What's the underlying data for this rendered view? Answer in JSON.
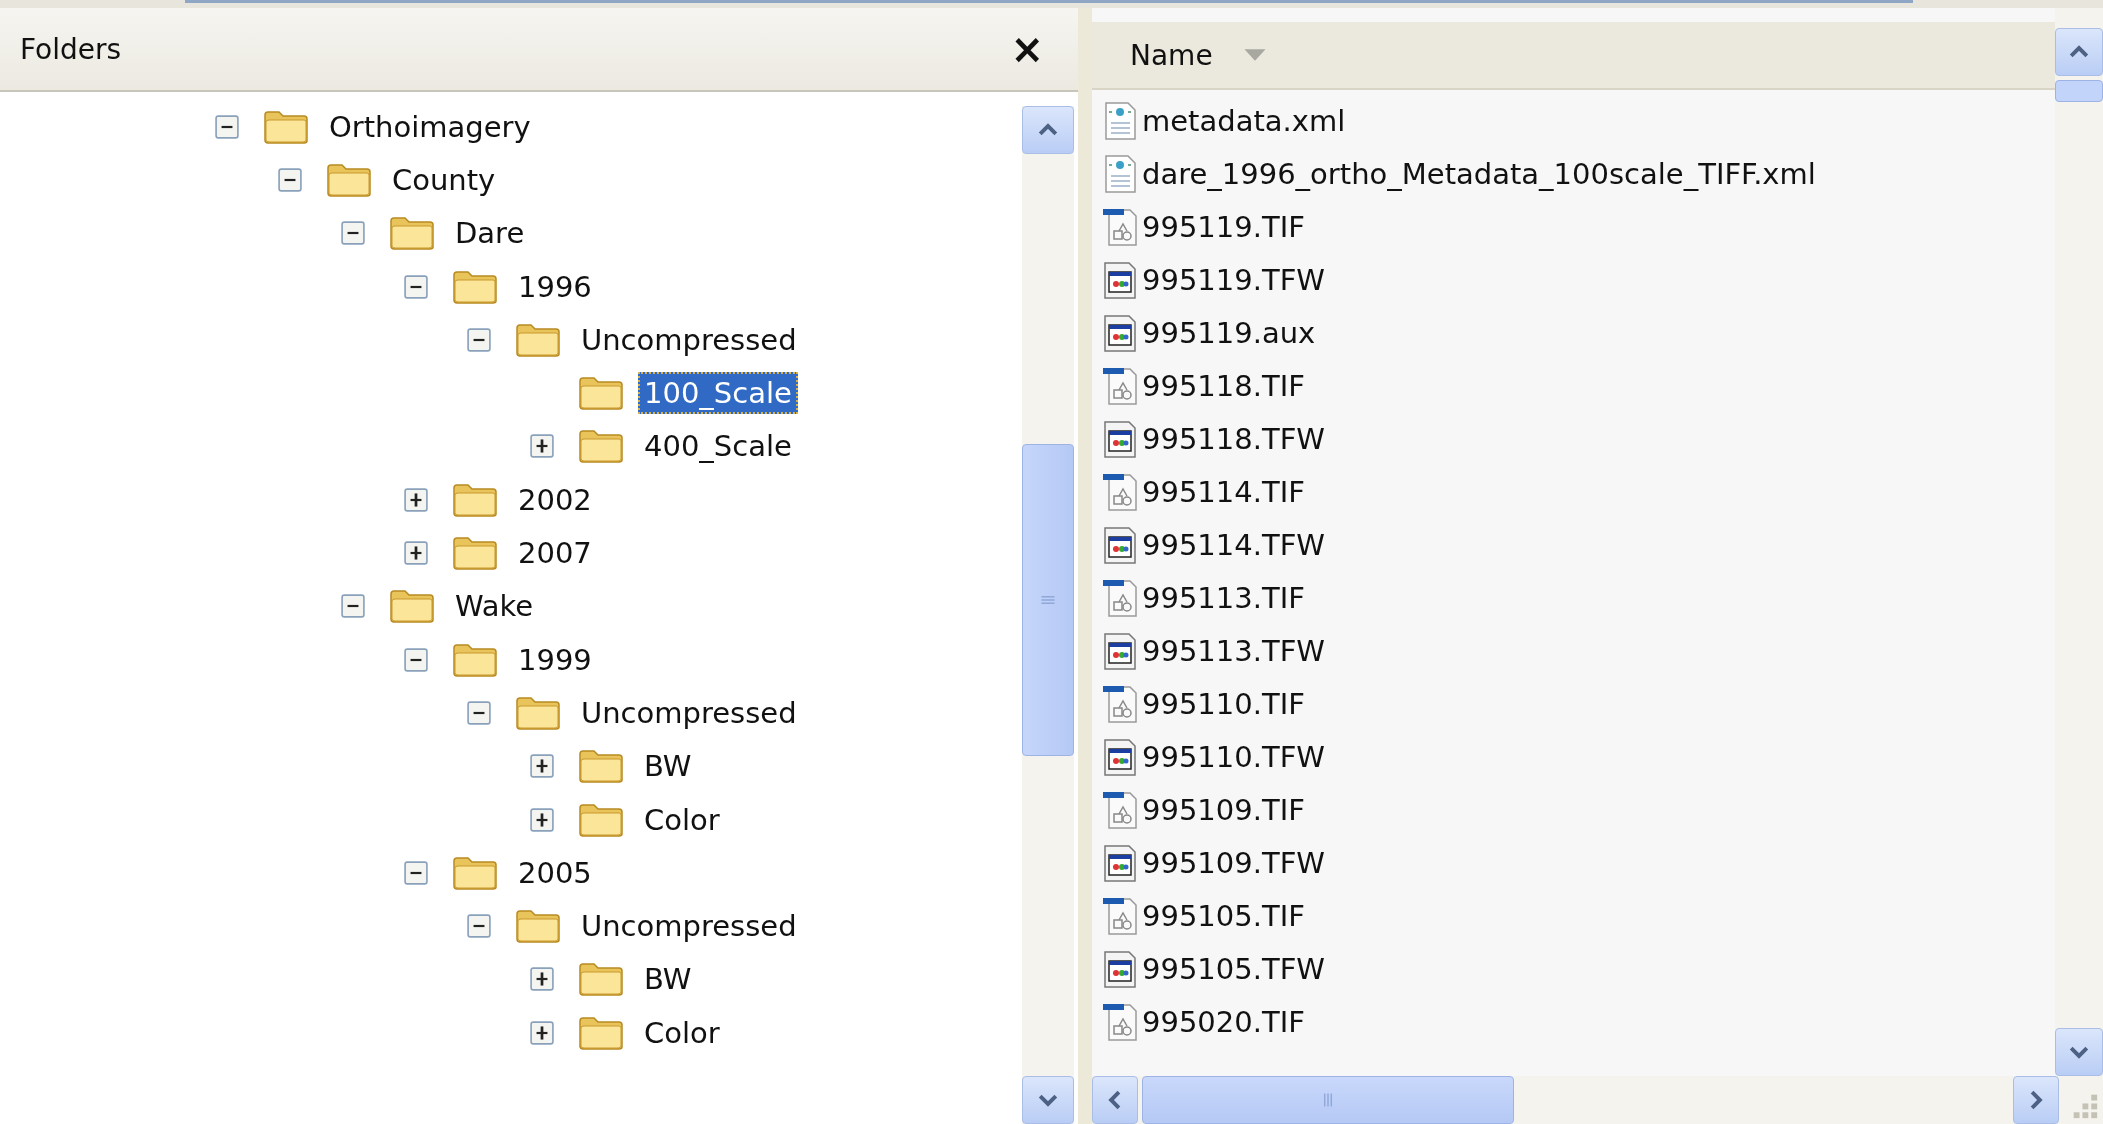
{
  "folders_pane": {
    "title": "Folders",
    "close": "×",
    "tree": [
      {
        "label": "Orthoimagery",
        "kind": "expandable",
        "expanded": true,
        "selected": false,
        "children": [
          {
            "label": "County",
            "kind": "expandable",
            "expanded": true,
            "selected": false,
            "children": [
              {
                "label": "Dare",
                "kind": "expandable",
                "expanded": true,
                "selected": false,
                "children": [
                  {
                    "label": "1996",
                    "kind": "expandable",
                    "expanded": true,
                    "selected": false,
                    "children": [
                      {
                        "label": "Uncompressed",
                        "kind": "expandable",
                        "expanded": true,
                        "selected": false,
                        "children": [
                          {
                            "label": "100_Scale",
                            "kind": "leaf",
                            "selected": true
                          },
                          {
                            "label": "400_Scale",
                            "kind": "expandable",
                            "expanded": false,
                            "selected": false
                          }
                        ]
                      }
                    ]
                  },
                  {
                    "label": "2002",
                    "kind": "expandable",
                    "expanded": false,
                    "selected": false
                  },
                  {
                    "label": "2007",
                    "kind": "expandable",
                    "expanded": false,
                    "selected": false
                  }
                ]
              },
              {
                "label": "Wake",
                "kind": "expandable",
                "expanded": true,
                "selected": false,
                "children": [
                  {
                    "label": "1999",
                    "kind": "expandable",
                    "expanded": true,
                    "selected": false,
                    "children": [
                      {
                        "label": "Uncompressed",
                        "kind": "expandable",
                        "expanded": true,
                        "selected": false,
                        "children": [
                          {
                            "label": "BW",
                            "kind": "expandable",
                            "expanded": false,
                            "selected": false
                          },
                          {
                            "label": "Color",
                            "kind": "expandable",
                            "expanded": false,
                            "selected": false
                          }
                        ]
                      }
                    ]
                  },
                  {
                    "label": "2005",
                    "kind": "expandable",
                    "expanded": true,
                    "selected": false,
                    "children": [
                      {
                        "label": "Uncompressed",
                        "kind": "expandable",
                        "expanded": true,
                        "selected": false,
                        "children": [
                          {
                            "label": "BW",
                            "kind": "expandable",
                            "expanded": false,
                            "selected": false
                          },
                          {
                            "label": "Color",
                            "kind": "expandable",
                            "expanded": false,
                            "selected": false
                          }
                        ]
                      }
                    ]
                  }
                ]
              }
            ]
          }
        ]
      }
    ]
  },
  "files_pane": {
    "column": "Name",
    "files": [
      {
        "name": "metadata.xml",
        "kind": "xml"
      },
      {
        "name": "dare_1996_ortho_Metadata_100scale_TIFF.xml",
        "kind": "xml"
      },
      {
        "name": "995119.TIF",
        "kind": "image"
      },
      {
        "name": "995119.TFW",
        "kind": "app"
      },
      {
        "name": "995119.aux",
        "kind": "app"
      },
      {
        "name": "995118.TIF",
        "kind": "image"
      },
      {
        "name": "995118.TFW",
        "kind": "app"
      },
      {
        "name": "995114.TIF",
        "kind": "image"
      },
      {
        "name": "995114.TFW",
        "kind": "app"
      },
      {
        "name": "995113.TIF",
        "kind": "image"
      },
      {
        "name": "995113.TFW",
        "kind": "app"
      },
      {
        "name": "995110.TIF",
        "kind": "image"
      },
      {
        "name": "995110.TFW",
        "kind": "app"
      },
      {
        "name": "995109.TIF",
        "kind": "image"
      },
      {
        "name": "995109.TFW",
        "kind": "app"
      },
      {
        "name": "995105.TIF",
        "kind": "image"
      },
      {
        "name": "995105.TFW",
        "kind": "app"
      },
      {
        "name": "995020.TIF",
        "kind": "image"
      }
    ]
  }
}
